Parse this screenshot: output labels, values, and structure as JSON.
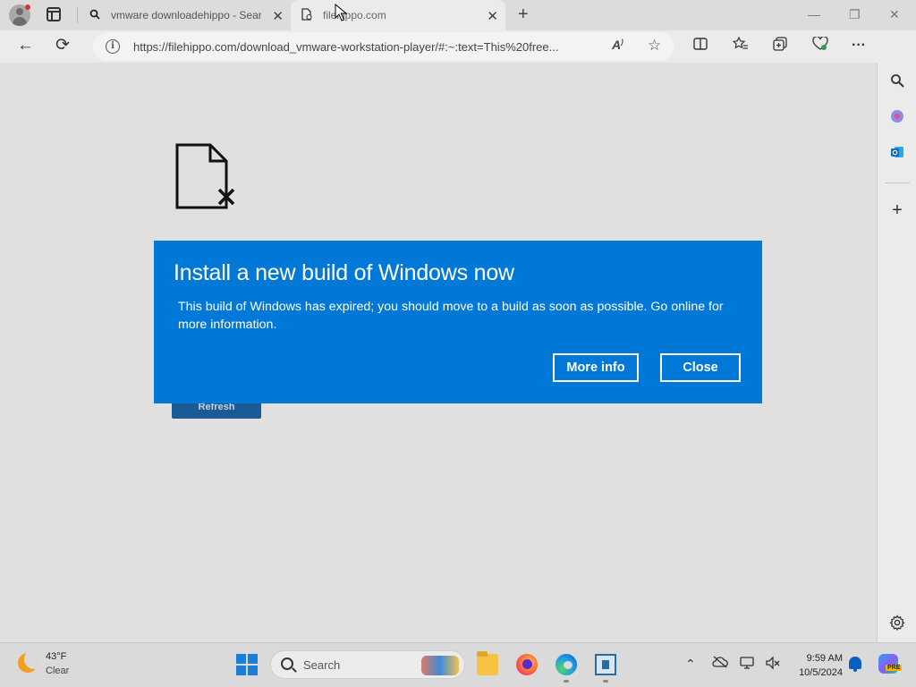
{
  "browser": {
    "tabs": [
      {
        "title": "vmware downloadehippo - Search",
        "favicon": "search-icon",
        "active": false
      },
      {
        "title": "filehippo.com",
        "favicon": "page-error-icon",
        "active": true
      }
    ],
    "address": {
      "url": "https://filehippo.com/download_vmware-workstation-player/#:~:text=This%20free..."
    }
  },
  "page": {
    "refresh_label": "Refresh"
  },
  "dialog": {
    "title": "Install a new build of Windows now",
    "message": "This build of Windows has expired; you should move to a build as soon as possible. Go online for more information.",
    "more_info_label": "More info",
    "close_label": "Close",
    "background_color": "#0078d7"
  },
  "toolbar": {
    "notification_count": "1"
  },
  "taskbar": {
    "weather": {
      "temperature": "43°F",
      "condition": "Clear"
    },
    "search_placeholder": "Search",
    "clock": {
      "time": "9:59 AM",
      "date": "10/5/2024"
    },
    "copilot_badge": "PRE"
  }
}
